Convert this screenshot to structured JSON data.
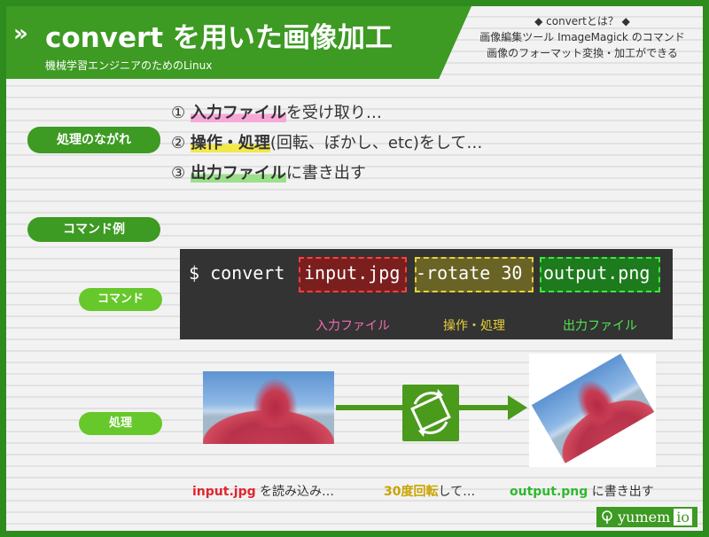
{
  "header": {
    "arrows": "»",
    "title": "convert を用いた画像加工",
    "subtitle": "機械学習エンジニアのためのLinux",
    "note_lines": [
      "◆ convertとは？ ◆",
      "画像編集ツール ImageMagick のコマンド",
      "画像のフォーマット変換・加工ができる"
    ]
  },
  "flow": {
    "label": "処理のながれ",
    "steps": [
      {
        "num": "①",
        "highlight": "入力ファイル",
        "rest": "を受け取り…"
      },
      {
        "num": "②",
        "highlight": "操作・処理",
        "rest": "(回転、ぼかし、etc)をして…"
      },
      {
        "num": "③",
        "highlight": "出力ファイル",
        "rest": "に書き出す"
      }
    ]
  },
  "example": {
    "label": "コマンド例",
    "command_label": "コマンド",
    "prompt": "$ convert",
    "input": "input.jpg",
    "operation": "-rotate 30",
    "output": "output.png",
    "input_caption": "入力ファイル",
    "operation_caption": "操作・処理",
    "output_caption": "出力ファイル"
  },
  "process": {
    "label": "処理",
    "cap_input_file": "input.jpg",
    "cap_input_rest": " を読み込み…",
    "cap_op_hl": "30度回転",
    "cap_op_rest": "して…",
    "cap_output_file": "output.png",
    "cap_output_rest": " に書き出す"
  },
  "logo": {
    "text": "yumem",
    "suffix": "io",
    "icon": "tree-icon"
  },
  "colors": {
    "brand_green": "#3d9a22",
    "light_green": "#66c82a",
    "input_red": "#e0262e",
    "op_yellow": "#c9a400",
    "output_green": "#2fb82f"
  }
}
